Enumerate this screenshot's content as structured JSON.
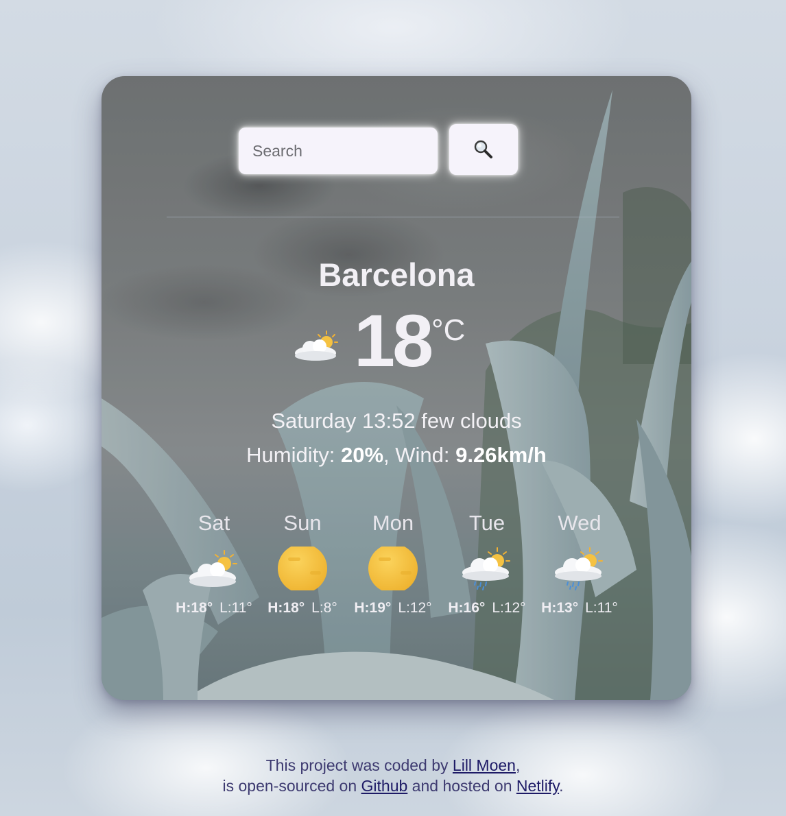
{
  "search": {
    "placeholder": "Search",
    "button_icon": "magnifier-icon"
  },
  "current": {
    "city": "Barcelona",
    "icon": "partly-cloudy-icon",
    "temperature": "18",
    "unit": "°C",
    "description": "Saturday 13:52 few clouds",
    "humidity_label": "Humidity:",
    "humidity_value": "20%",
    "wind_label": ", Wind:",
    "wind_value": "9.26km/h"
  },
  "forecast": [
    {
      "day": "Sat",
      "icon": "partly-cloudy-icon",
      "high": "H:18°",
      "low": "L:11°"
    },
    {
      "day": "Sun",
      "icon": "sun-icon",
      "high": "H:18°",
      "low": "L:8°"
    },
    {
      "day": "Mon",
      "icon": "sun-icon",
      "high": "H:19°",
      "low": "L:12°"
    },
    {
      "day": "Tue",
      "icon": "rain-cloud-sun-icon",
      "high": "H:16°",
      "low": "L:12°"
    },
    {
      "day": "Wed",
      "icon": "rain-cloud-sun-icon",
      "high": "H:13°",
      "low": "L:11°"
    }
  ],
  "footer": {
    "line1_prefix": "This project was coded by ",
    "author_link": "Lill Moen",
    "line1_suffix": ",",
    "line2_prefix": "is open-sourced on ",
    "github_link": "Github",
    "line2_middle": " and hosted on ",
    "netlify_link": "Netlify",
    "line2_suffix": "."
  }
}
